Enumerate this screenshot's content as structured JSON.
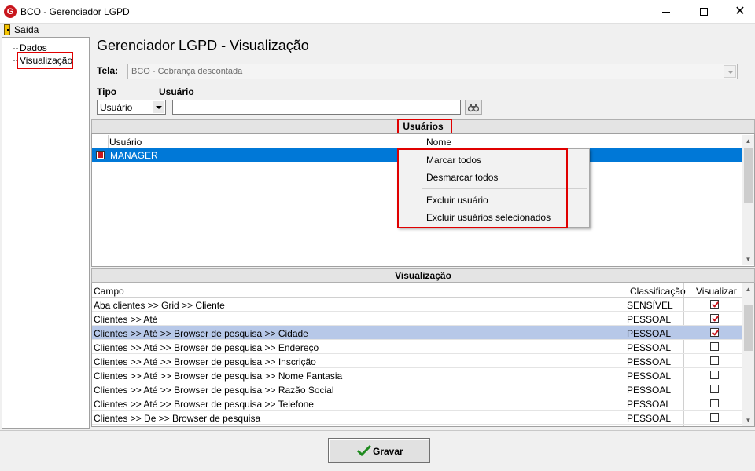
{
  "window": {
    "title": "BCO - Gerenciador LGPD",
    "logo": "G"
  },
  "menu": {
    "exit_label": "Saída"
  },
  "tree": {
    "items": [
      "Dados",
      "Visualização"
    ]
  },
  "main": {
    "title": "Gerenciador LGPD - Visualização",
    "tela_label": "Tela:",
    "tela_value": "BCO - Cobrança descontada",
    "tipo_label": "Tipo",
    "tipo_value": "Usuário",
    "usuario_label": "Usuário",
    "usuario_value": ""
  },
  "users_panel": {
    "header": "Usuários",
    "columns": [
      "Usuário",
      "Nome"
    ],
    "rows": [
      {
        "usuario": "MANAGER",
        "nome": "",
        "checked": true
      }
    ]
  },
  "context_menu": {
    "items": [
      "Marcar todos",
      "Desmarcar todos",
      "Excluir usuário",
      "Excluir usuários selecionados"
    ]
  },
  "vis_panel": {
    "header": "Visualização",
    "columns": [
      "Campo",
      "Classificação",
      "Visualizar"
    ],
    "rows": [
      {
        "campo": "Aba clientes >> Grid >> Cliente",
        "classificacao": "SENSÍVEL",
        "visualizar": true
      },
      {
        "campo": "Clientes >> Até",
        "classificacao": "PESSOAL",
        "visualizar": true
      },
      {
        "campo": "Clientes >> Até  >> Browser de pesquisa >> Cidade",
        "classificacao": "PESSOAL",
        "visualizar": true
      },
      {
        "campo": "Clientes >> Até  >> Browser de pesquisa >> Endereço",
        "classificacao": "PESSOAL",
        "visualizar": false
      },
      {
        "campo": "Clientes >> Até  >> Browser de pesquisa >> Inscrição",
        "classificacao": "PESSOAL",
        "visualizar": false
      },
      {
        "campo": "Clientes >> Até  >> Browser de pesquisa >> Nome Fantasia",
        "classificacao": "PESSOAL",
        "visualizar": false
      },
      {
        "campo": "Clientes >> Até  >> Browser de pesquisa >> Razão Social",
        "classificacao": "PESSOAL",
        "visualizar": false
      },
      {
        "campo": "Clientes >> Até  >> Browser de pesquisa >> Telefone",
        "classificacao": "PESSOAL",
        "visualizar": false
      },
      {
        "campo": "Clientes >> De >> Browser de pesquisa",
        "classificacao": "PESSOAL",
        "visualizar": false
      }
    ]
  },
  "footer": {
    "save_label": "Gravar"
  },
  "colors": {
    "selection": "#0078d7",
    "row_highlight": "#b7c8e8",
    "annotation_red": "#e00000",
    "brand": "#c8161d"
  }
}
